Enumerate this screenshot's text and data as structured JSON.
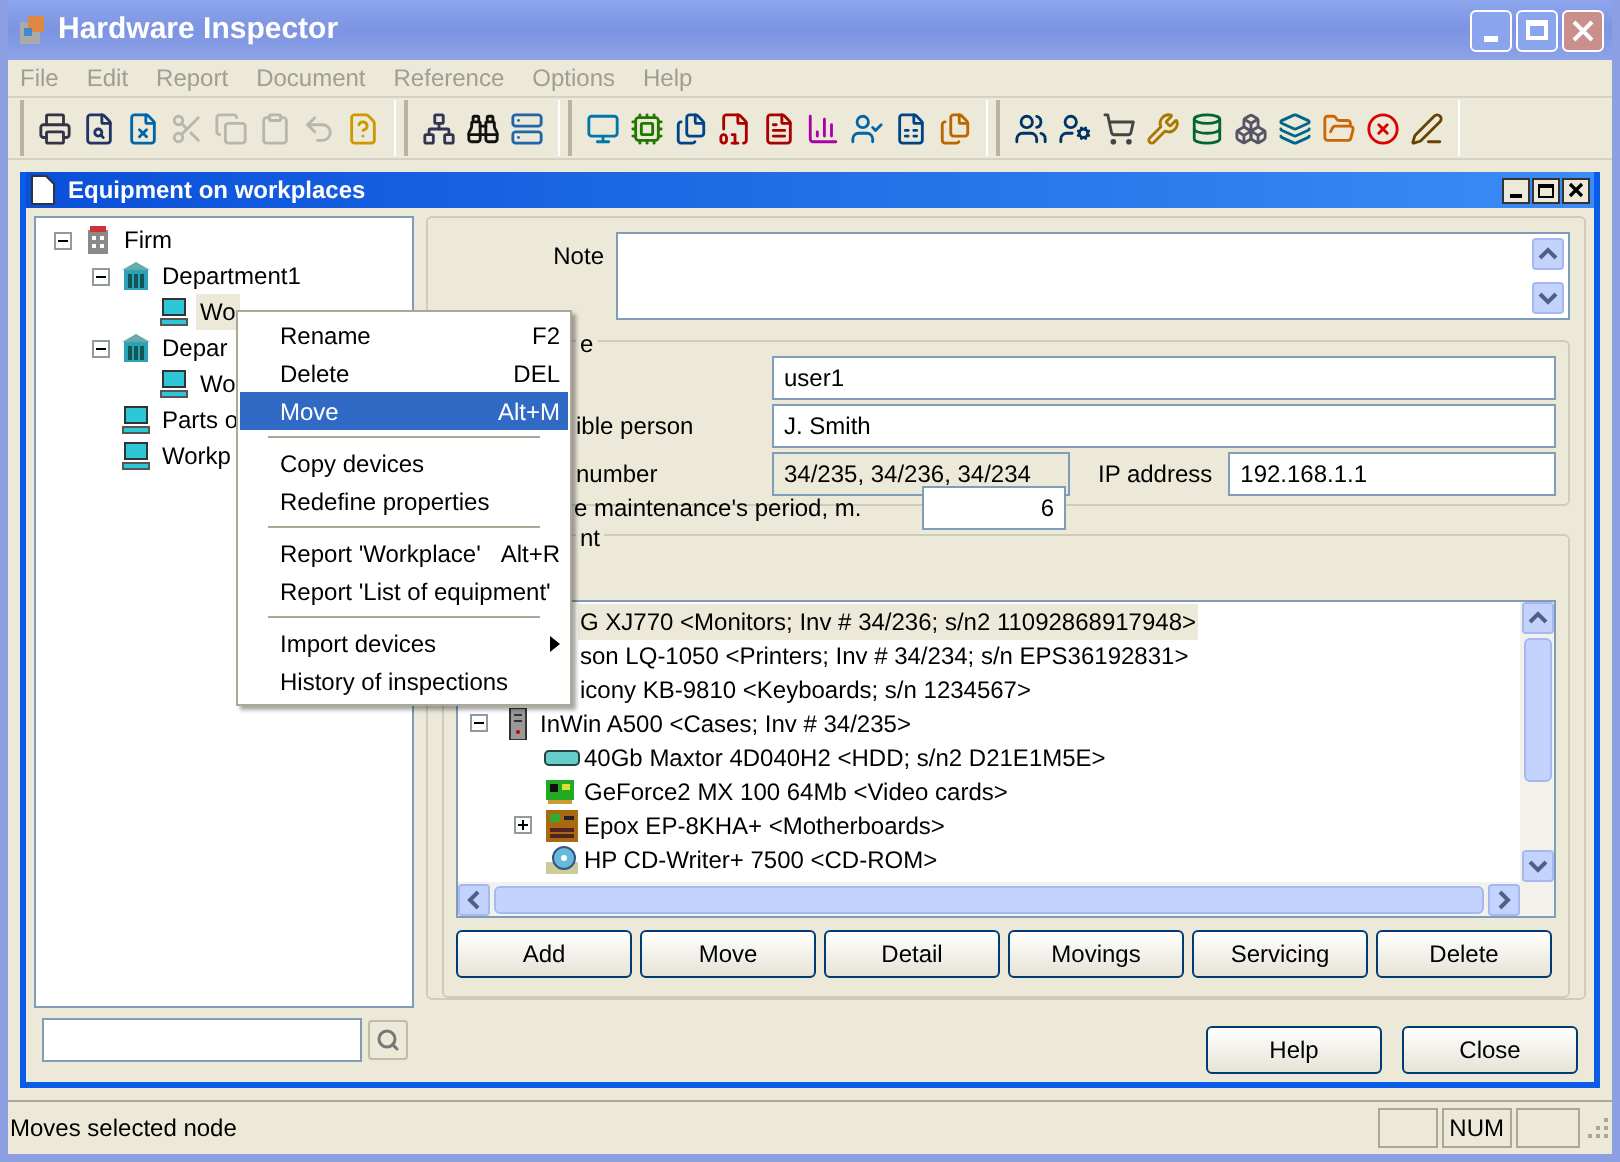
{
  "window": {
    "title": "Hardware Inspector"
  },
  "menu_bar": [
    {
      "label": "File",
      "disabled": true
    },
    {
      "label": "Edit",
      "disabled": true
    },
    {
      "label": "Report",
      "disabled": true
    },
    {
      "label": "Document",
      "disabled": true
    },
    {
      "label": "Reference",
      "disabled": true
    },
    {
      "label": "Options",
      "disabled": true
    },
    {
      "label": "Help",
      "disabled": true
    }
  ],
  "toolbar_groups": [
    [
      {
        "disabled": false
      },
      {
        "disabled": false
      },
      {
        "disabled": false
      },
      {
        "disabled": true
      },
      {
        "disabled": true
      },
      {
        "disabled": true
      },
      {
        "disabled": true
      },
      {
        "disabled": false
      }
    ],
    [
      {
        "disabled": false
      },
      {
        "disabled": false
      },
      {
        "disabled": false
      }
    ],
    [
      {
        "disabled": false
      },
      {
        "disabled": false
      },
      {
        "disabled": false
      },
      {
        "disabled": false
      },
      {
        "disabled": false
      },
      {
        "disabled": false
      },
      {
        "disabled": false
      },
      {
        "disabled": false
      },
      {
        "disabled": false
      }
    ],
    [
      {
        "disabled": false
      },
      {
        "disabled": false
      },
      {
        "disabled": false
      },
      {
        "disabled": false
      },
      {
        "disabled": false
      },
      {
        "disabled": false
      },
      {
        "disabled": false
      },
      {
        "disabled": false
      },
      {
        "disabled": false
      },
      {
        "disabled": false
      }
    ]
  ],
  "child_window": {
    "title": "Equipment on workplaces"
  },
  "tree": [
    {
      "label": "Firm",
      "kind": "firm",
      "expanded": true,
      "selected": false,
      "children": [
        {
          "label": "Department1",
          "kind": "department",
          "expanded": true,
          "selected": false,
          "children": [
            {
              "label": "Wo",
              "kind": "workplace",
              "selected": true
            }
          ]
        },
        {
          "label": "Depar",
          "kind": "department",
          "expanded": true,
          "selected": false,
          "children": [
            {
              "label": "Wo",
              "kind": "workplace",
              "selected": false
            }
          ]
        },
        {
          "label": "Parts o",
          "kind": "workplace",
          "selected": false
        },
        {
          "label": "Workp",
          "kind": "workplace",
          "selected": false
        }
      ]
    }
  ],
  "form": {
    "note_label": "Note",
    "group_title": "e",
    "user_field": {
      "value": "user1"
    },
    "responsible_field": {
      "label": "ible person",
      "value": "J. Smith"
    },
    "inventory_field": {
      "label": "number",
      "value": "34/235, 34/236, 34/234",
      "readonly": true
    },
    "ip_field": {
      "label": "IP address",
      "value": "192.168.1.1"
    },
    "period_field": {
      "label": "e maintenance's period, m.",
      "value": "6"
    }
  },
  "equipment": {
    "title": "nt",
    "items": [
      {
        "text": "G XJ770 <Monitors; Inv # 34/236; s/n2 11092868917948>",
        "selected": true
      },
      {
        "text": "son LQ-1050 <Printers; Inv # 34/234; s/n EPS36192831>",
        "selected": false
      },
      {
        "text": "icony KB-9810 <Keyboards; s/n 1234567>",
        "selected": false
      },
      {
        "kind": "case",
        "text": "InWin A500 <Cases; Inv # 34/235>",
        "selected": false,
        "expanded": true,
        "children": [
          {
            "kind": "hdd",
            "text": "40Gb Maxtor 4D040H2 <HDD; s/n2 D21E1M5E>",
            "selected": false
          },
          {
            "kind": "video",
            "text": "GeForce2 MX 100 64Mb <Video cards>",
            "selected": false
          },
          {
            "kind": "motherboard",
            "text": "Epox EP-8KHA+ <Motherboards>",
            "selected": false,
            "expanded": false
          },
          {
            "kind": "cdrom",
            "text": "HP CD-Writer+ 7500 <CD-ROM>",
            "selected": false
          }
        ]
      }
    ],
    "buttons": [
      "Add",
      "Move",
      "Detail",
      "Movings",
      "Servicing",
      "Delete"
    ]
  },
  "dialog_buttons": [
    "Help",
    "Close"
  ],
  "context_menu": {
    "groups": [
      [
        {
          "label": "Rename",
          "shortcut": "F2",
          "selected": false,
          "submenu": false
        },
        {
          "label": "Delete",
          "shortcut": "DEL",
          "selected": false,
          "submenu": false
        },
        {
          "label": "Move",
          "shortcut": "Alt+M",
          "selected": true,
          "submenu": false
        }
      ],
      [
        {
          "label": "Copy devices",
          "selected": false,
          "submenu": false
        },
        {
          "label": "Redefine properties",
          "selected": false,
          "submenu": false
        }
      ],
      [
        {
          "label": "Report 'Workplace'",
          "shortcut": "Alt+R",
          "selected": false,
          "submenu": false
        },
        {
          "label": "Report 'List of equipment'",
          "selected": false,
          "submenu": false
        }
      ],
      [
        {
          "label": "Import devices",
          "selected": false,
          "submenu": true
        },
        {
          "label": "History of inspections",
          "selected": false,
          "submenu": false
        }
      ]
    ]
  },
  "status_bar": {
    "message": "Moves selected node",
    "indicators": [
      "NUM"
    ]
  }
}
